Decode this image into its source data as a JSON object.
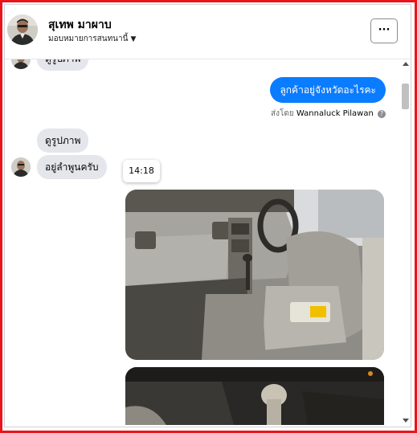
{
  "header": {
    "name": "สุเทพ มาผาบ",
    "subtitle": "มอบหมายการสนทนานี้",
    "more_label": "···"
  },
  "messages": {
    "partial_top": "ดูรูปภาพ",
    "outgoing": "ลูกค้าอยู่จังหวัดอะไรคะ",
    "sent_by_prefix": "ส่งโดย",
    "sent_by_name": "Wannaluck Pilawan",
    "sent_by_help": "?",
    "incoming_1": "ดูรูปภาพ",
    "incoming_2": "อยู่ลำพูนครับ",
    "timestamp": "14:18"
  },
  "colors": {
    "outgoing_bubble": "#0a7cff",
    "incoming_bubble": "#e4e6eb",
    "frame_border": "#e8151b"
  }
}
